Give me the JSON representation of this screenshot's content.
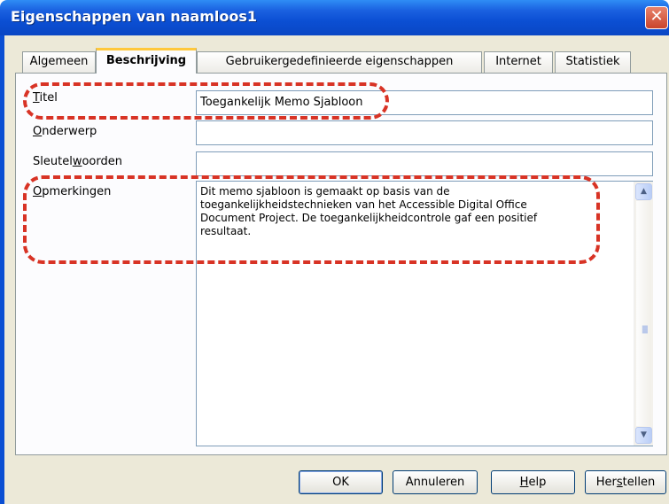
{
  "window": {
    "title": "Eigenschappen van naamloos1",
    "close_glyph": "✕"
  },
  "tabs": [
    {
      "label": "Algemeen"
    },
    {
      "label": "Beschrijving",
      "active": true
    },
    {
      "label": "Gebruikergedefinieerde eigenschappen"
    },
    {
      "label": "Internet"
    },
    {
      "label": "Statistiek"
    }
  ],
  "form": {
    "title_label_mnemonic": "T",
    "title_label_rest": "itel",
    "title_value": "Toegankelijk Memo Sjabloon",
    "subject_label_mnemonic": "O",
    "subject_label_rest": "nderwerp",
    "subject_value": "",
    "keywords_label_pre": "Sleutel",
    "keywords_label_mnemonic": "w",
    "keywords_label_post": "oorden",
    "keywords_value": "",
    "comments_label_mnemonic": "O",
    "comments_label_rest": "pmerkingen",
    "comments_value": "Dit memo sjabloon is gemaakt op basis van de\ntoegankelijkheidstechnieken van het Accessible Digital Office\nDocument Project. De toegankelijkheidcontrole gaf een positief\nresultaat."
  },
  "buttons": {
    "ok": "OK",
    "cancel": "Annuleren",
    "help_mnemonic": "H",
    "help_rest": "elp",
    "reset_pre": "Her",
    "reset_mnemonic": "s",
    "reset_post": "tellen"
  },
  "colors": {
    "titlebar": "#0b4fd3",
    "dialog_bg": "#ece9d8",
    "annotation": "#d83325",
    "active_tab_accent": "#ffc83c"
  }
}
